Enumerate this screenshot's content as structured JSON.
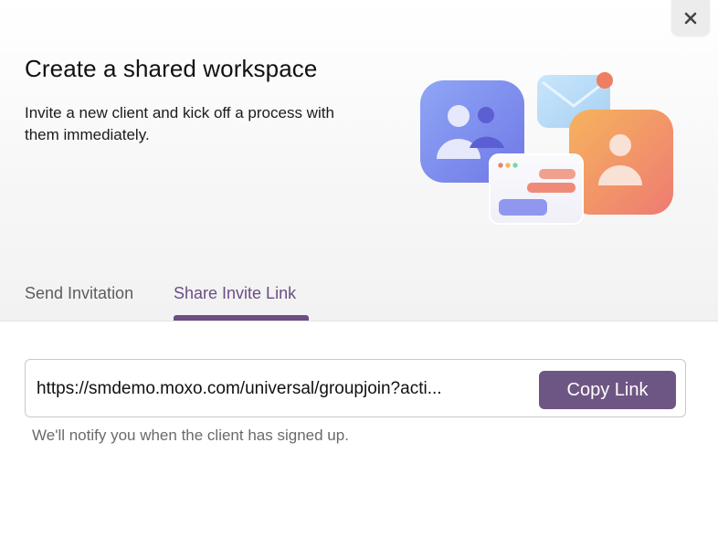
{
  "dialog": {
    "title": "Create a shared workspace",
    "subtitle": "Invite a new client and kick off a process with them immediately.",
    "close_icon": "close-icon"
  },
  "tabs": [
    {
      "label": "Send Invitation",
      "active": false
    },
    {
      "label": "Share Invite Link",
      "active": true
    }
  ],
  "invite": {
    "link": "https://smdemo.moxo.com/universal/groupjoin?acti...",
    "copy_label": "Copy Link",
    "note": "We'll notify you when the client has signed up."
  },
  "colors": {
    "accent": "#6b4e84",
    "button": "#6e5684"
  }
}
